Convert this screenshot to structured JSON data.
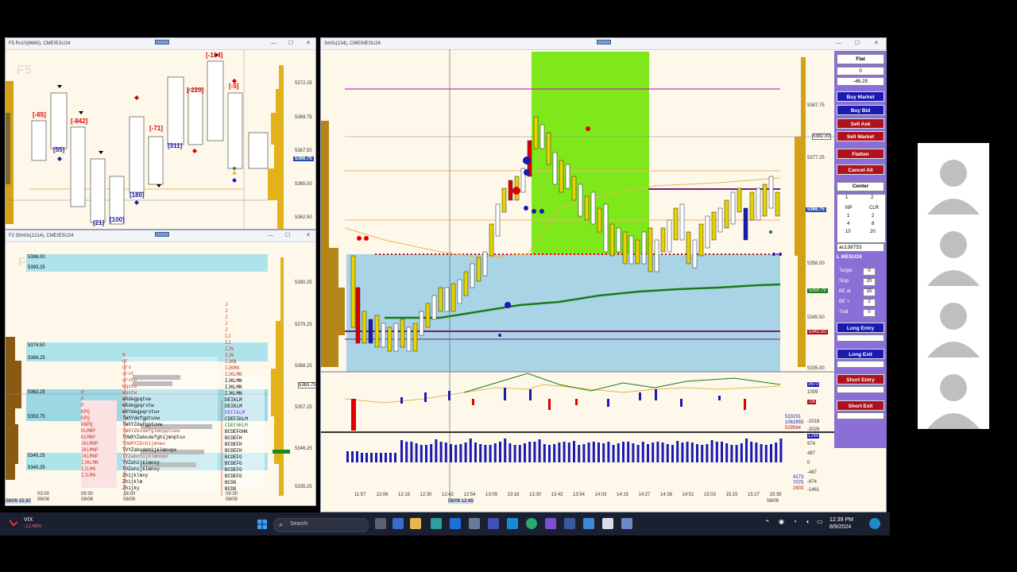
{
  "window_f5": {
    "title": "F5 Rv10(6660), CME/ESU24",
    "watermark": "F5",
    "prices": [
      "5372.25",
      "5369.75",
      "5367.50",
      "5365.00",
      "5362.50"
    ],
    "current_price": "5366.75",
    "labels": [
      "[-65]",
      "[-842]",
      "[55]",
      "[-134]",
      "[-71]",
      "[-220]",
      "[-5]",
      "[311]",
      "[180]",
      "[21]",
      "[100]"
    ]
  },
  "window_f2": {
    "title": "F2 30m0s(1214), CME/ESU24",
    "watermark": "F",
    "prices": [
      "5390.25",
      "5379.25",
      "5368.25",
      "5357.25",
      "5346.25",
      "5335.25"
    ],
    "levels": [
      "5398.00",
      "5393.25",
      "5374.50",
      "5369.25",
      "5362.25",
      "5353.75",
      "5345.25",
      "5340.25"
    ],
    "price_box": "5363.75",
    "times": [
      "03:00",
      "09:30",
      "18:00",
      "09:30"
    ],
    "dates": [
      "08/08",
      "08/08",
      "08/08",
      "08/09"
    ],
    "footer": "08/09 15:30"
  },
  "window_main": {
    "title": "3m0s(134), CME/MESU24",
    "prices": [
      "5387.75",
      "5377.25",
      "5366.75",
      "5356.00",
      "5345.50",
      "5335.00"
    ],
    "current_price": "5366.75",
    "crosshair_price": "5382.00",
    "green_price": "5350.75",
    "red_price": "5342.50",
    "ind_values": [
      "3673",
      "1009",
      "-18",
      "533291",
      "1062855",
      "529564",
      "-2018",
      "-3028"
    ],
    "vol_values": [
      "1269",
      "974",
      "487",
      "0",
      "-487",
      "-974",
      "-1461"
    ],
    "vol_side": [
      "4173",
      "7075",
      "2903"
    ],
    "times": [
      "11:57",
      "12:06",
      "12:18",
      "12:30",
      "12:42",
      "12:54",
      "13:09",
      "13:18",
      "13:30",
      "13:42",
      "13:54",
      "14:03",
      "14:15",
      "14:27",
      "14:38",
      "14:51",
      "15:03",
      "15:15",
      "15:27",
      "15:39"
    ],
    "last_date": "08/09",
    "crosshair_time": "08/09 12:49"
  },
  "order_panel": {
    "position": "Flat",
    "qty": "0",
    "pnl": "-46.25",
    "buy_market": "Buy Market",
    "buy_bid": "Buy Bid",
    "sell_ask": "Sell Ask",
    "sell_market": "Sell Market",
    "flatten": "Flatten",
    "cancel_all": "Cancel All",
    "center": "Center",
    "qty_left": "1",
    "qty_right": "2",
    "np": "NP",
    "clr": "CLR",
    "grid": [
      "1",
      "2",
      "4",
      "8",
      "10",
      "20"
    ],
    "account": "ac138753",
    "instrument": "L MESU24",
    "target_label": "Target",
    "target_val": "0",
    "stop_label": "Stop",
    "stop_val": "20",
    "be_at_label": "BE at",
    "be_at_val": "15",
    "be_plus_label": "BE +",
    "be_plus_val": "2",
    "trail_label": "Trail",
    "trail_val": "0",
    "long_entry": "Long Entry",
    "long_exit": "Long Exit",
    "short_entry": "Short Entry",
    "short_exit": "Short Exit"
  },
  "taskbar": {
    "ticker": "VIX",
    "ticker_change": "-12.48%",
    "search": "Search",
    "time": "12:39 PM",
    "date": "8/9/2024"
  },
  "colors": {
    "buy": "#1a1ab0",
    "sell": "#b0121c",
    "panel": "#8a6fd6",
    "highlight": "#7fe81a",
    "value_area": "#a9d4e6"
  }
}
